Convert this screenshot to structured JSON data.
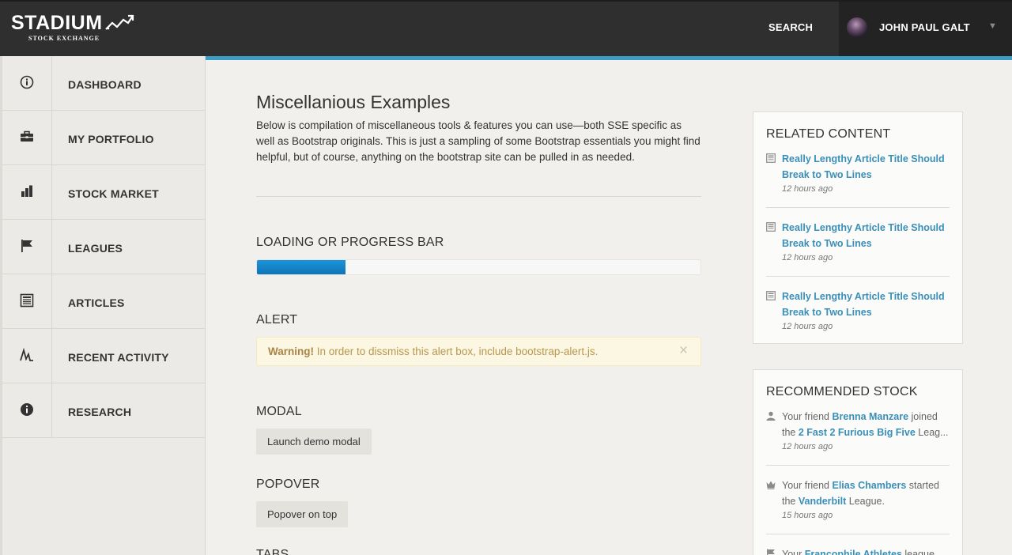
{
  "header": {
    "logo_text": "STADIUM",
    "logo_subtext": "STOCK EXCHANGE",
    "search_label": "SEARCH",
    "user_name": "JOHN PAUL GALT",
    "caret": "▼"
  },
  "sidebar": {
    "items": [
      {
        "label": "DASHBOARD",
        "icon": "info-circle-icon"
      },
      {
        "label": "MY PORTFOLIO",
        "icon": "briefcase-icon"
      },
      {
        "label": "STOCK MARKET",
        "icon": "bar-chart-icon"
      },
      {
        "label": "LEAGUES",
        "icon": "flag-icon"
      },
      {
        "label": "ARTICLES",
        "icon": "newspaper-icon"
      },
      {
        "label": "RECENT ACTIVITY",
        "icon": "activity-icon"
      },
      {
        "label": "RESEARCH",
        "icon": "info-filled-icon"
      }
    ]
  },
  "main": {
    "title": "Miscellanious Examples",
    "intro": "Below is compilation of miscellaneous tools & features you can use—both SSE specific as well as Bootstrap originals. This is just a sampling of some Bootstrap essentials you might find helpful, but of course, anything on the bootstrap site can be pulled in as needed.",
    "progress_title": "LOADING OR PROGRESS BAR",
    "progress_value": 0.2,
    "alert_title": "ALERT",
    "alert_strong": "Warning!",
    "alert_text": " In order to dissmiss this alert box, include bootstrap-alert.js.",
    "alert_close": "×",
    "modal_title": "MODAL",
    "modal_button": "Launch demo modal",
    "popover_title": "POPOVER",
    "popover_button": "Popover on top",
    "tabs_title": "TABS"
  },
  "related": {
    "title": "RELATED CONTENT",
    "items": [
      {
        "title": "Really Lengthy Article Title Should Break to Two Lines",
        "time": "12 hours ago"
      },
      {
        "title": "Really Lengthy Article Title Should Break to Two Lines",
        "time": "12 hours ago"
      },
      {
        "title": "Really Lengthy Article Title Should Break to Two Lines",
        "time": "12 hours ago"
      }
    ]
  },
  "recommended": {
    "title": "RECOMMENDED STOCK",
    "items": [
      {
        "pre": "Your friend ",
        "link1": "Brenna Manzare",
        "mid": " joined the ",
        "link2": "2 Fast 2 Furious Big Five",
        "post": " Leag...",
        "time": "12 hours ago",
        "icon": "user-icon"
      },
      {
        "pre": "Your friend ",
        "link1": "Elias Chambers",
        "mid": " started the ",
        "link2": "Vanderbilt",
        "post": " League.",
        "time": "15 hours ago",
        "icon": "crown-icon"
      },
      {
        "pre": "Your ",
        "link1": "Francophile Athletes",
        "mid": " league has",
        "icon": "flag-icon"
      }
    ]
  }
}
